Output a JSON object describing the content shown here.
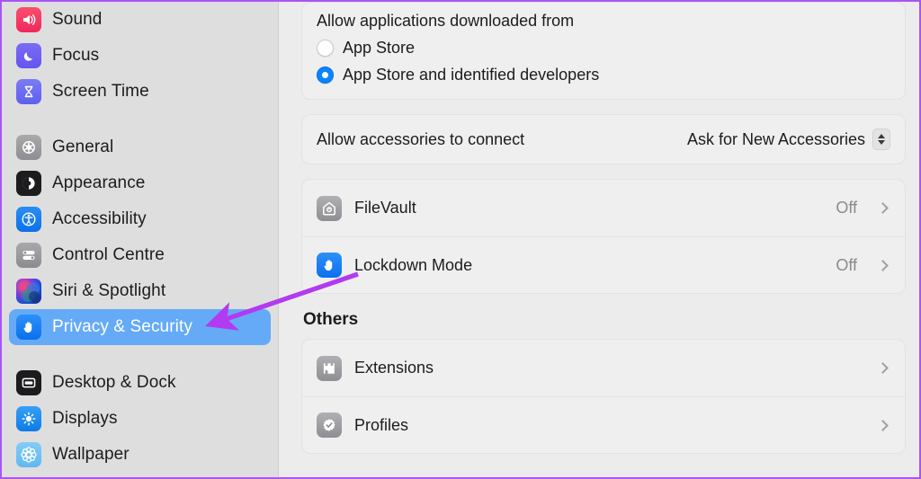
{
  "annotation": {
    "arrow_color": "#b23af0",
    "points_to": "Privacy & Security"
  },
  "sidebar": {
    "groups": [
      {
        "items": [
          {
            "label": "Sound",
            "icon": "speaker-icon",
            "selected": false
          },
          {
            "label": "Focus",
            "icon": "moon-icon",
            "selected": false
          },
          {
            "label": "Screen Time",
            "icon": "hourglass-icon",
            "selected": false
          }
        ]
      },
      {
        "items": [
          {
            "label": "General",
            "icon": "gear-icon",
            "selected": false
          },
          {
            "label": "Appearance",
            "icon": "contrast-circle-icon",
            "selected": false
          },
          {
            "label": "Accessibility",
            "icon": "accessibility-person-icon",
            "selected": false
          },
          {
            "label": "Control Centre",
            "icon": "sliders-icon",
            "selected": false
          },
          {
            "label": "Siri & Spotlight",
            "icon": "siri-orb-icon",
            "selected": false
          },
          {
            "label": "Privacy & Security",
            "icon": "hand-icon",
            "selected": true
          }
        ]
      },
      {
        "items": [
          {
            "label": "Desktop & Dock",
            "icon": "desktop-icon",
            "selected": false
          },
          {
            "label": "Displays",
            "icon": "brightness-icon",
            "selected": false
          },
          {
            "label": "Wallpaper",
            "icon": "flower-icon",
            "selected": false
          }
        ]
      }
    ],
    "selected_color": "#65aaf7"
  },
  "main": {
    "gatekeeper": {
      "label": "Allow applications downloaded from",
      "options": [
        {
          "label": "App Store",
          "selected": false
        },
        {
          "label": "App Store and identified developers",
          "selected": true
        }
      ]
    },
    "accessories": {
      "label": "Allow accessories to connect",
      "value": "Ask for New Accessories",
      "control": "popup-button"
    },
    "security_rows": [
      {
        "title": "FileVault",
        "status": "Off",
        "icon": "house-vault-icon"
      },
      {
        "title": "Lockdown Mode",
        "status": "Off",
        "icon": "hand-icon"
      }
    ],
    "others": {
      "header": "Others",
      "rows": [
        {
          "title": "Extensions",
          "status": "",
          "icon": "puzzle-piece-icon"
        },
        {
          "title": "Profiles",
          "status": "",
          "icon": "check-badge-icon"
        }
      ]
    }
  }
}
